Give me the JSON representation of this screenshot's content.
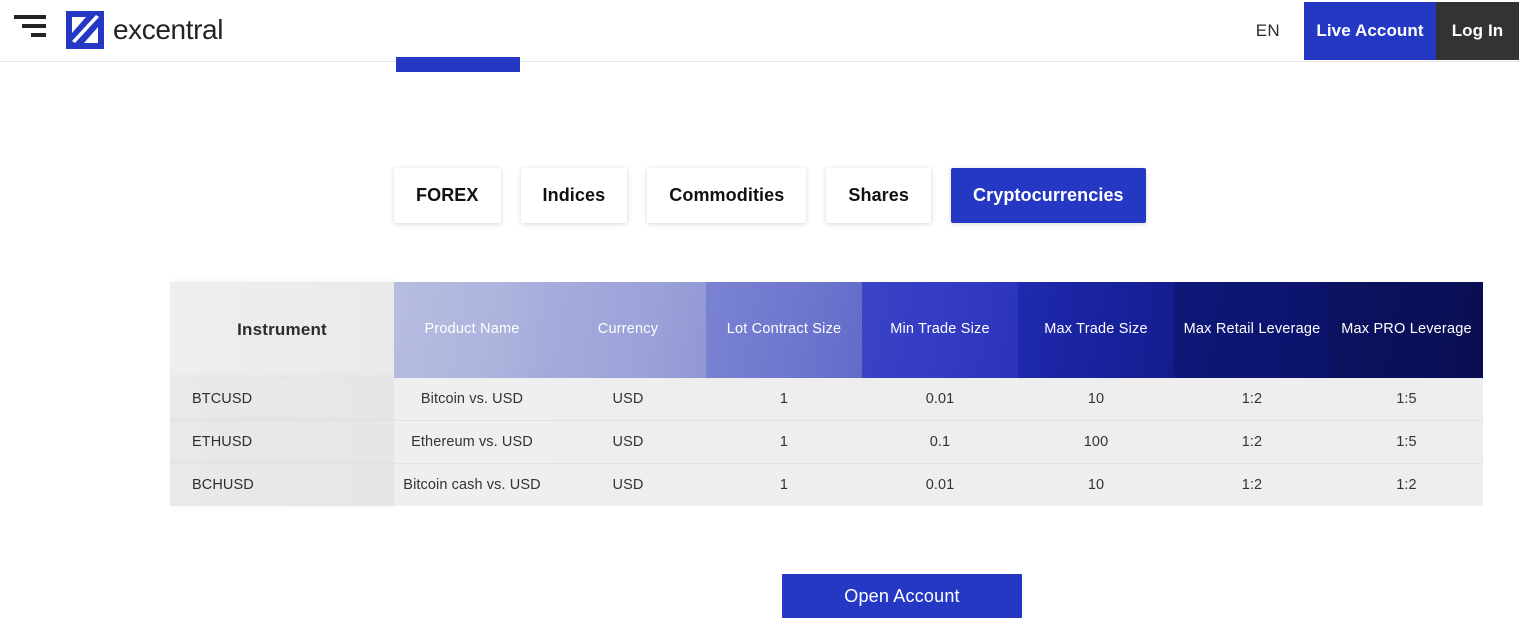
{
  "header": {
    "menu_icon": "hamburger-menu-icon",
    "logo_icon": "excentral-logo-mark",
    "brand_name": "excentral",
    "language": "EN",
    "live_account_label": "Live Account",
    "log_in_label": "Log In",
    "accent_color": "#2538c4",
    "login_color": "#333333"
  },
  "tabs": [
    {
      "label": "FOREX",
      "active": false
    },
    {
      "label": "Indices",
      "active": false
    },
    {
      "label": "Commodities",
      "active": false
    },
    {
      "label": "Shares",
      "active": false
    },
    {
      "label": "Cryptocurrencies",
      "active": true
    }
  ],
  "table": {
    "columns": [
      "Instrument",
      "Product Name",
      "Currency",
      "Lot Contract Size",
      "Min Trade Size",
      "Max Trade Size",
      "Max Retail Leverage",
      "Max PRO Leverage"
    ],
    "rows": [
      {
        "instrument": "BTCUSD",
        "product_name": "Bitcoin vs. USD",
        "currency": "USD",
        "lot_contract_size": "1",
        "min_trade_size": "0.01",
        "max_trade_size": "10",
        "max_retail_leverage": "1:2",
        "max_pro_leverage": "1:5"
      },
      {
        "instrument": "ETHUSD",
        "product_name": "Ethereum vs. USD",
        "currency": "USD",
        "lot_contract_size": "1",
        "min_trade_size": "0.1",
        "max_trade_size": "100",
        "max_retail_leverage": "1:2",
        "max_pro_leverage": "1:5"
      },
      {
        "instrument": "BCHUSD",
        "product_name": "Bitcoin cash vs. USD",
        "currency": "USD",
        "lot_contract_size": "1",
        "min_trade_size": "0.01",
        "max_trade_size": "10",
        "max_retail_leverage": "1:2",
        "max_pro_leverage": "1:2"
      }
    ]
  },
  "cta": {
    "open_account_label": "Open Account"
  }
}
